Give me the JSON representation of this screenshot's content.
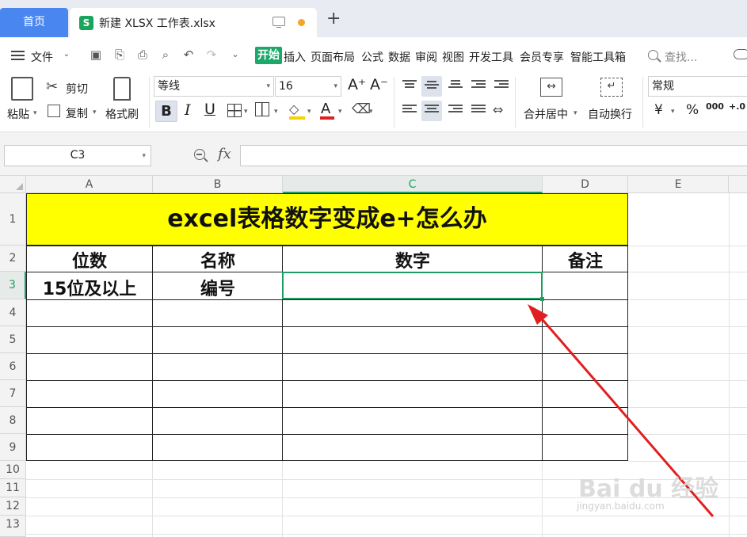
{
  "tabs": {
    "home_label": "首页",
    "file_icon": "S",
    "file_name": "新建 XLSX 工作表.xlsx",
    "new_tab": "+"
  },
  "menubar": {
    "file_label": "文件",
    "start_label": "开始",
    "items": [
      "插入",
      "页面布局",
      "公式",
      "数据",
      "审阅",
      "视图",
      "开发工具",
      "会员专享",
      "智能工具箱"
    ],
    "search_placeholder": "查找..."
  },
  "ribbon": {
    "paste": "粘贴",
    "cut": "剪切",
    "copy": "复制",
    "format_painter": "格式刷",
    "font_name": "等线",
    "font_size": "16",
    "bold": "B",
    "italic": "I",
    "underline": "U",
    "font_color_glyph": "A",
    "increase_font": "A⁺",
    "decrease_font": "A⁻",
    "merge_center": "合并居中",
    "wrap_text": "自动换行",
    "number_format": "常规",
    "currency": "¥",
    "percent": "%",
    "thousands": "000",
    "decimal": "+.0"
  },
  "colors": {
    "accent_green": "#1e9e63",
    "tab_blue": "#4a86f0",
    "title_fill": "#ffff00",
    "arrow_red": "#e02020"
  },
  "formula_bar": {
    "name_box": "C3",
    "fx": "fx",
    "value": ""
  },
  "sheet": {
    "columns": [
      "A",
      "B",
      "C",
      "D",
      "E"
    ],
    "rows": [
      "1",
      "2",
      "3",
      "4",
      "5",
      "6",
      "7",
      "8",
      "9",
      "10",
      "11",
      "12",
      "13"
    ],
    "active_cell": "C3",
    "title": "excel表格数字变成e+怎么办",
    "headers": [
      "位数",
      "名称",
      "数字",
      "备注"
    ],
    "row3": [
      "15位及以上",
      "编号",
      "",
      ""
    ]
  },
  "watermark": {
    "brand": "Bai du 经验",
    "url": "jingyan.baidu.com"
  }
}
